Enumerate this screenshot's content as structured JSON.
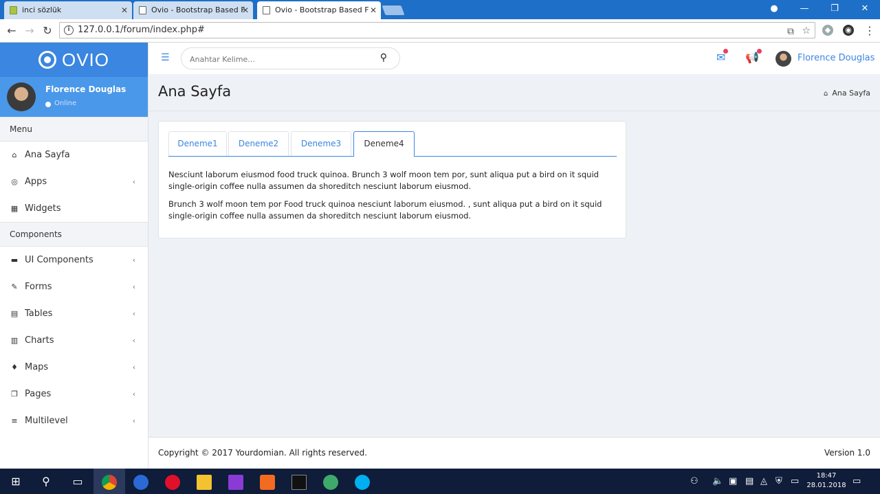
{
  "browser": {
    "tabs": [
      {
        "title": "inci sözlük"
      },
      {
        "title": "Ovio - Bootstrap Based F"
      },
      {
        "title": "Ovio - Bootstrap Based F"
      }
    ],
    "url": "127.0.0.1/forum/index.php#"
  },
  "sidebar": {
    "brand": "OVIO",
    "user": {
      "name": "Florence Douglas",
      "status": "Online"
    },
    "sections": [
      {
        "header": "Menu",
        "items": [
          {
            "label": "Ana Sayfa",
            "icon": "home-icon",
            "glyph": "⌂",
            "chevron": false
          },
          {
            "label": "Apps",
            "icon": "target-icon",
            "glyph": "◎",
            "chevron": true
          },
          {
            "label": "Widgets",
            "icon": "grid-icon",
            "glyph": "▦",
            "chevron": false
          }
        ]
      },
      {
        "header": "Components",
        "items": [
          {
            "label": "UI Components",
            "icon": "briefcase-icon",
            "glyph": "▬",
            "chevron": true
          },
          {
            "label": "Forms",
            "icon": "edit-icon",
            "glyph": "✎",
            "chevron": true
          },
          {
            "label": "Tables",
            "icon": "table-icon",
            "glyph": "▤",
            "chevron": true
          },
          {
            "label": "Charts",
            "icon": "bar-chart-icon",
            "glyph": "▥",
            "chevron": true
          },
          {
            "label": "Maps",
            "icon": "map-marker-icon",
            "glyph": "♦",
            "chevron": true
          },
          {
            "label": "Pages",
            "icon": "copy-icon",
            "glyph": "❐",
            "chevron": true
          },
          {
            "label": "Multilevel",
            "icon": "list-icon",
            "glyph": "≡",
            "chevron": true
          }
        ]
      }
    ],
    "chevron_glyph": "‹"
  },
  "header": {
    "search_placeholder": "Anahtar Kelime...",
    "user_name": "Florence Douglas"
  },
  "page": {
    "title": "Ana Sayfa",
    "breadcrumb": "Ana Sayfa"
  },
  "card": {
    "tabs": [
      {
        "label": "Deneme1"
      },
      {
        "label": "Deneme2"
      },
      {
        "label": "Deneme3"
      },
      {
        "label": "Deneme4"
      }
    ],
    "active_tab": "Deneme4",
    "paragraphs": [
      "Nesciunt laborum eiusmod food truck quinoa. Brunch 3 wolf moon tem por, sunt aliqua put a bird on it squid single-origin coffee nulla assumen da shoreditch nesciunt laborum eiusmod.",
      "Brunch 3 wolf moon tem por Food truck quinoa nesciunt laborum eiusmod. , sunt aliqua put a bird on it squid single-origin coffee nulla assumen da shoreditch nesciunt laborum eiusmod."
    ]
  },
  "footer": {
    "copyright": "Copyright © 2017 Yourdomian. All rights reserved.",
    "version": "Version 1.0"
  },
  "taskbar": {
    "time": "18:47",
    "date": "28.01.2018"
  },
  "colors": {
    "accent": "#3a86e0",
    "brand_bg": "#3a86e0",
    "user_bg": "#4a98ea",
    "notification": "#e8405b"
  }
}
